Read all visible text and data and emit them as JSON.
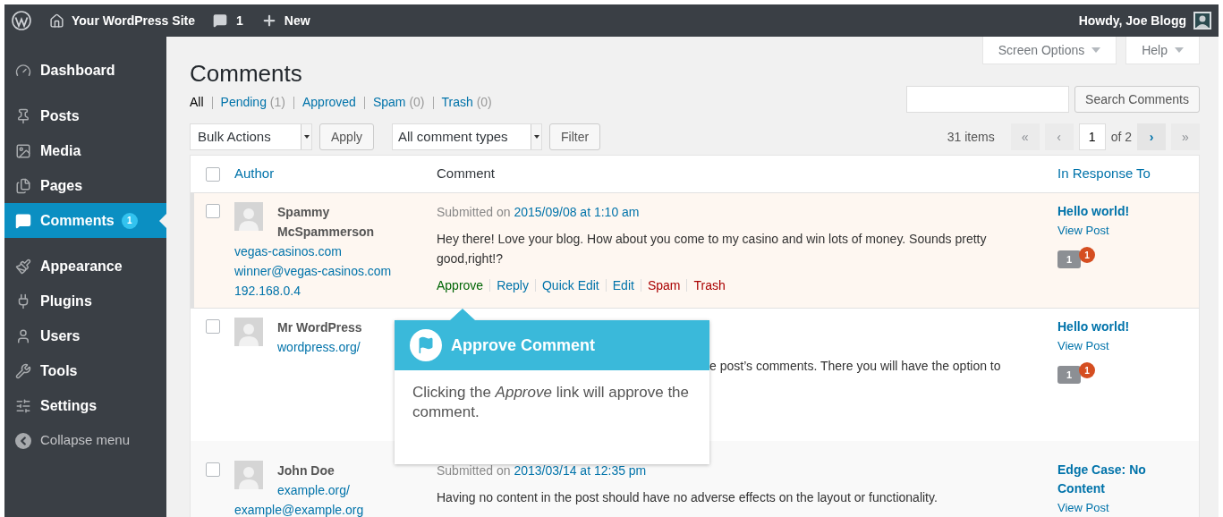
{
  "admin_bar": {
    "site_name": "Your WordPress Site",
    "comments_count": "1",
    "new_label": "New",
    "greeting": "Howdy, Joe Blogg"
  },
  "sidebar": {
    "groups": [
      {
        "items": [
          {
            "label": "Dashboard",
            "selected": false
          }
        ]
      },
      {
        "items": [
          {
            "label": "Posts",
            "selected": false
          },
          {
            "label": "Media",
            "selected": false
          },
          {
            "label": "Pages",
            "selected": false
          },
          {
            "label": "Comments",
            "selected": true,
            "badge": "1"
          }
        ]
      },
      {
        "items": [
          {
            "label": "Appearance",
            "selected": false
          },
          {
            "label": "Plugins",
            "selected": false
          },
          {
            "label": "Users",
            "selected": false
          },
          {
            "label": "Tools",
            "selected": false
          },
          {
            "label": "Settings",
            "selected": false
          }
        ]
      }
    ],
    "collapse_label": "Collapse menu"
  },
  "screen_tabs": [
    "Screen Options",
    "Help"
  ],
  "page_title": "Comments",
  "status_links": [
    {
      "label": "All",
      "selected": true
    },
    {
      "label": "Pending",
      "count": "(1)",
      "selected": false
    },
    {
      "label": "Approved",
      "selected": false
    },
    {
      "label": "Spam",
      "count": "(0)",
      "selected": false
    },
    {
      "label": "Trash",
      "count": "(0)",
      "selected": false
    }
  ],
  "search": {
    "button": "Search Comments"
  },
  "bulk_actions": {
    "value": "Bulk Actions",
    "apply": "Apply"
  },
  "type_filter": {
    "value": "All comment types",
    "filter": "Filter"
  },
  "pagination": {
    "items": "31 items",
    "page": "1",
    "of": "of 2",
    "buttons": [
      {
        "label": "«",
        "disabled": true
      },
      {
        "label": "‹",
        "disabled": true
      },
      {
        "label": "›",
        "disabled": false
      },
      {
        "label": "»",
        "disabled": true
      }
    ]
  },
  "table": {
    "select_all_checked": false,
    "columns": [
      {
        "label": "Author",
        "sortable": true
      },
      {
        "label": "Comment",
        "sortable": false
      },
      {
        "label": "In Response To",
        "sortable": true
      }
    ],
    "rows": [
      {
        "unapproved": true,
        "checked": false,
        "author": {
          "name": "Spammy McSpammerson",
          "links": [
            "vegas-casinos.com",
            "winner@vegas-casinos.com",
            "192.168.0.4"
          ]
        },
        "submitted": {
          "prefix": "Submitted on",
          "date": "2015/09/08 at 1:10 am"
        },
        "text": "Hey there! Love your blog. How about you come to my casino and win lots of money. Sounds pretty good,right!?",
        "actions": [
          {
            "label": "Approve",
            "kind": "approve"
          },
          {
            "label": "Reply",
            "kind": "link"
          },
          {
            "label": "Quick Edit",
            "kind": "link"
          },
          {
            "label": "Edit",
            "kind": "link"
          },
          {
            "label": "Spam",
            "kind": "danger"
          },
          {
            "label": "Trash",
            "kind": "danger"
          }
        ],
        "response": {
          "title": "Hello world!",
          "view": "View Post",
          "count": "1",
          "pending": "1"
        }
      },
      {
        "unapproved": false,
        "checked": false,
        "author": {
          "name": "Mr WordPress",
          "inline_link": "wordpress.org/"
        },
        "text_fragment": "e post’s comments. There you will have the option to",
        "response": {
          "title": "Hello world!",
          "view": "View Post",
          "count": "1",
          "pending": "1"
        }
      },
      {
        "unapproved": false,
        "checked": false,
        "author": {
          "name": "John Doe",
          "inline_link": "example.org/",
          "links": [
            "example@example.org"
          ]
        },
        "submitted": {
          "prefix": "Submitted on",
          "date": "2013/03/14 at 12:35 pm"
        },
        "text": "Having no content in the post should have no adverse effects on the layout or functionality.",
        "response": {
          "title": "Edge Case: No Content",
          "view": "View Post"
        }
      }
    ]
  },
  "pointer": {
    "title": "Approve Comment",
    "body": "Clicking the *Approve* link will approve the comment."
  }
}
